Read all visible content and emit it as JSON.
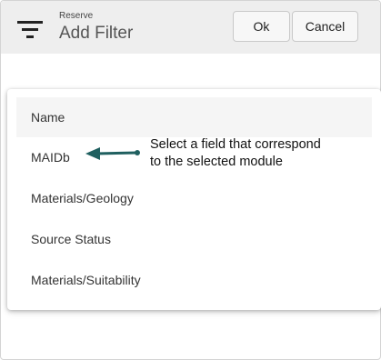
{
  "dialog": {
    "subtitle": "Reserve",
    "title": "Add Filter",
    "ok_label": "Ok",
    "cancel_label": "Cancel"
  },
  "dropdown": {
    "items": [
      {
        "label": "Name",
        "highlighted": true
      },
      {
        "label": "MAIDb"
      },
      {
        "label": "Materials/Geology"
      },
      {
        "label": "Source Status"
      },
      {
        "label": "Materials/Suitability"
      }
    ]
  },
  "annotation": {
    "text_line1": "Select a field that correspond",
    "text_line2": "to the selected module",
    "arrow_color": "#1f5f5f"
  },
  "icons": {
    "filter": "filter-icon"
  }
}
